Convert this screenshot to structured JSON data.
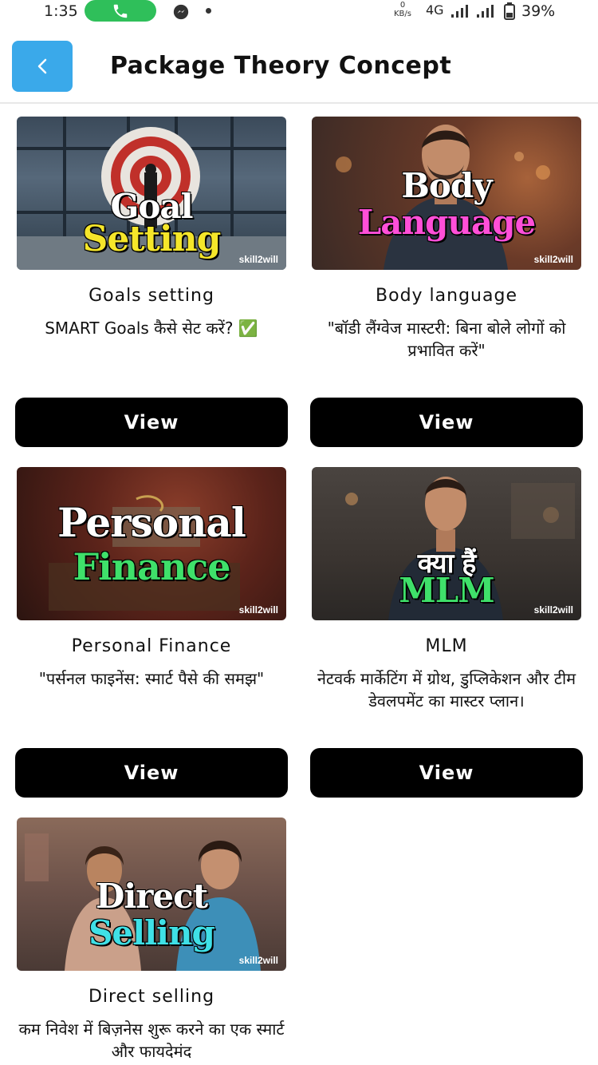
{
  "status_bar": {
    "time": "1:35",
    "speed_value": "0",
    "speed_unit": "KB/s",
    "network": "4G",
    "battery": "39%"
  },
  "header": {
    "title": "Package Theory Concept",
    "back_icon": "chevron-left-icon"
  },
  "brand_mark": "skill2will",
  "cards": [
    {
      "thumb_line1": "Goal",
      "thumb_line2": "Setting",
      "title": "Goals setting",
      "desc": "SMART Goals कैसे सेट करें? ✅",
      "button": "View"
    },
    {
      "thumb_line1": "Body",
      "thumb_line2": "Language",
      "title": "Body  language",
      "desc": "\"बॉडी लैंग्वेज मास्टरी: बिना बोले लोगों को प्रभावित करें\"",
      "button": "View"
    },
    {
      "thumb_line1": "Personal",
      "thumb_line2": "Finance",
      "title": "Personal Finance",
      "desc": "\"पर्सनल फाइनेंस: स्मार्ट पैसे की समझ\"",
      "button": "View"
    },
    {
      "thumb_line1": "क्या हैं",
      "thumb_line2": "MLM",
      "title": "MLM",
      "desc": "नेटवर्क मार्केटिंग में ग्रोथ, डुप्लिकेशन और टीम डेवलपमेंट का मास्टर प्लान।",
      "button": "View"
    },
    {
      "thumb_line1": "Direct",
      "thumb_line2": "Selling",
      "title": "Direct selling",
      "desc": "कम निवेश में बिज़नेस शुरू करने का एक स्मार्ट और फायदेमंद",
      "button": ""
    }
  ],
  "colors": {
    "accent": "#3aa9ea",
    "button_bg": "#000000",
    "call_pill": "#2fbf5a"
  }
}
